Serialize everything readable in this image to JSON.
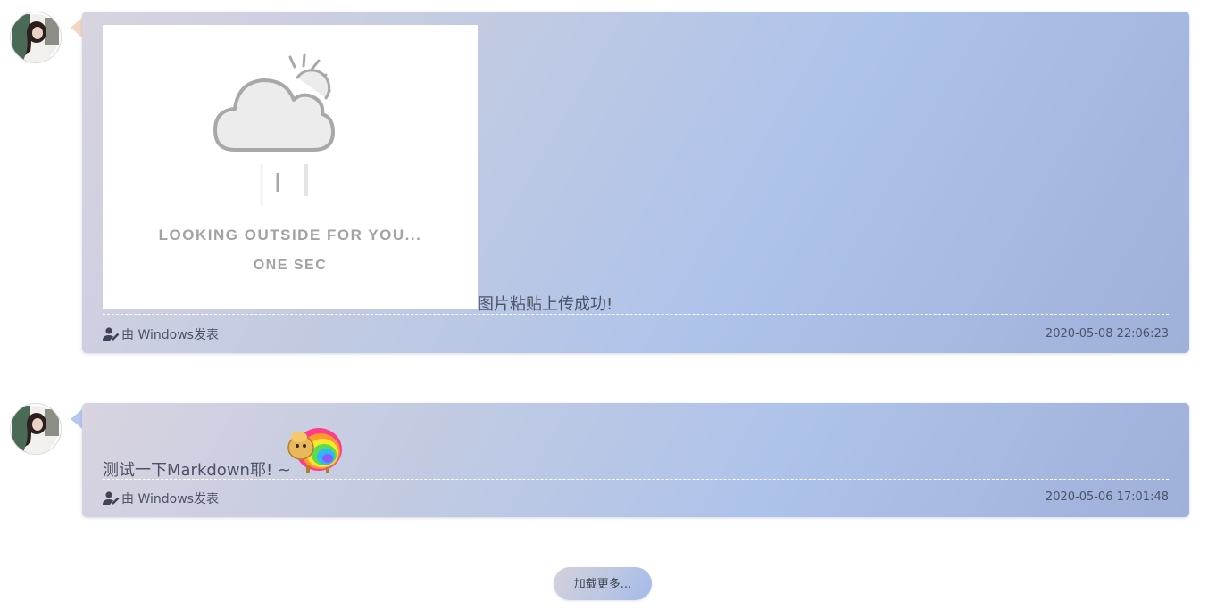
{
  "posts": [
    {
      "image": {
        "line1": "LOOKING OUTSIDE FOR YOU...",
        "line2": "ONE SEC"
      },
      "text": "图片粘贴上传成功!",
      "author": "由 Windows发表",
      "date": "2020-05-08 22:06:23"
    },
    {
      "text": "测试一下Markdown耶! ~",
      "author": "由 Windows发表",
      "date": "2020-05-06 17:01:48"
    }
  ],
  "load_more": {
    "label": "加载更多..."
  },
  "icons": {
    "avatar": "user-avatar",
    "author": "user-edit-icon",
    "weather": "cloud-sun-rain-icon",
    "emoji": "rainbow-sheep-emoji"
  }
}
